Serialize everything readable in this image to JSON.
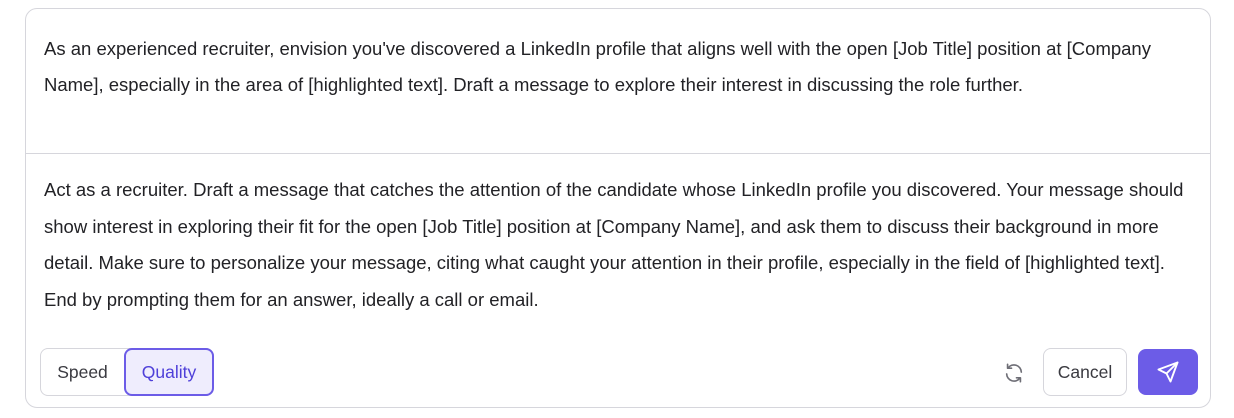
{
  "prompt": {
    "original_text": "As an experienced recruiter, envision you've discovered a LinkedIn profile that aligns well with the open [Job Title] position at [Company Name], especially in the area of [highlighted text]. Draft a message to explore their interest in discussing the role further.",
    "rewritten_text": "Act as a recruiter. Draft a message that catches the attention of the candidate whose LinkedIn profile you discovered. Your message should show interest in exploring their fit for the open [Job Title] position at [Company Name], and ask them to discuss their background in more detail. Make sure to personalize your message, citing what caught your attention in their profile, especially in the field of [highlighted text]. End by prompting them for an answer, ideally a call or email."
  },
  "modes": {
    "options": [
      "Speed",
      "Quality"
    ],
    "selected": "Quality"
  },
  "actions": {
    "regenerate_icon": "refresh-icon",
    "cancel_label": "Cancel",
    "send_icon": "send-icon"
  },
  "colors": {
    "accent": "#6c5ce7",
    "accent_bg": "#efedfd",
    "border": "#d6d6dc",
    "text": "#222226"
  }
}
